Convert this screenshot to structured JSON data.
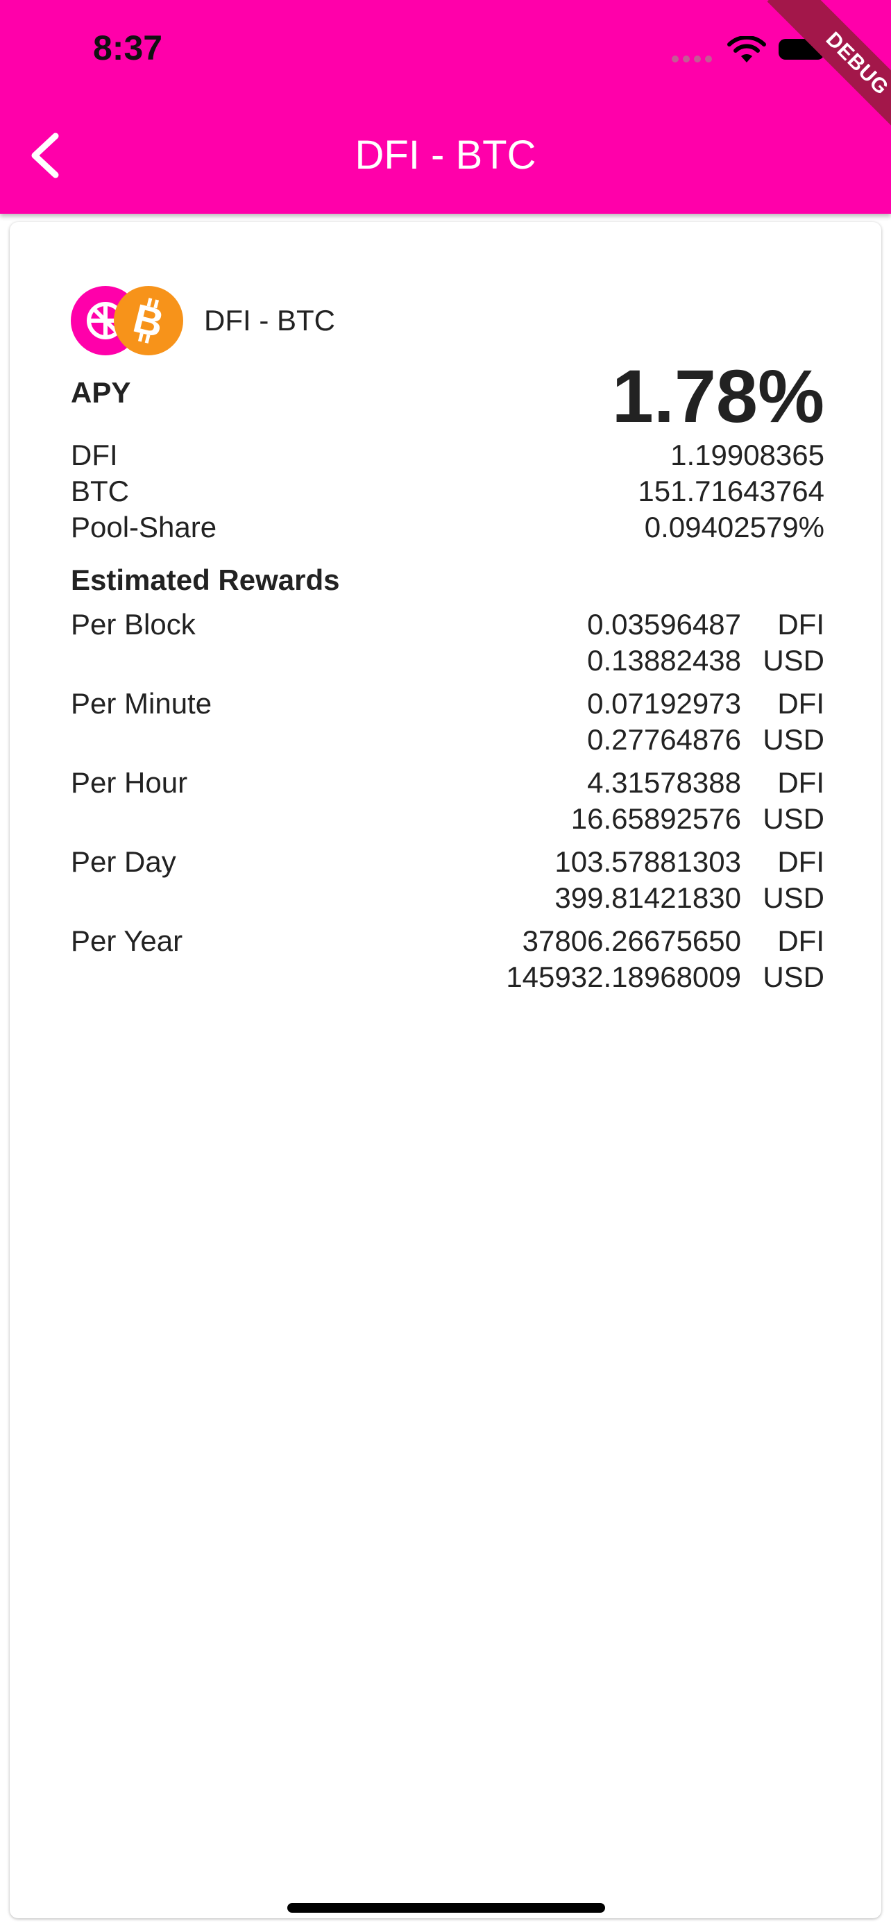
{
  "status_bar": {
    "time": "8:37"
  },
  "debug_banner": "DEBUG",
  "appbar": {
    "title": "DFI - BTC"
  },
  "pair": {
    "name": "DFI - BTC"
  },
  "apy": {
    "label": "APY",
    "value": "1.78%"
  },
  "info": [
    {
      "label": "DFI",
      "value": "1.19908365"
    },
    {
      "label": "BTC",
      "value": "151.71643764"
    },
    {
      "label": "Pool-Share",
      "value": "0.09402579%"
    }
  ],
  "rewards": {
    "title": "Estimated Rewards",
    "items": [
      {
        "label": "Per Block",
        "dfi": "0.03596487",
        "dfi_unit": "DFI",
        "usd": "0.13882438",
        "usd_unit": "USD"
      },
      {
        "label": "Per Minute",
        "dfi": "0.07192973",
        "dfi_unit": "DFI",
        "usd": "0.27764876",
        "usd_unit": "USD"
      },
      {
        "label": "Per Hour",
        "dfi": "4.31578388",
        "dfi_unit": "DFI",
        "usd": "16.65892576",
        "usd_unit": "USD"
      },
      {
        "label": "Per Day",
        "dfi": "103.57881303",
        "dfi_unit": "DFI",
        "usd": "399.81421830",
        "usd_unit": "USD"
      },
      {
        "label": "Per Year",
        "dfi": "37806.26675650",
        "dfi_unit": "DFI",
        "usd": "145932.18968009",
        "usd_unit": "USD"
      }
    ]
  },
  "colors": {
    "accent": "#ff00aa",
    "btc": "#f7931a",
    "dfi": "#ff00aa",
    "debug": "#a3174a"
  },
  "icons": [
    "back-arrow-icon",
    "wifi-icon",
    "battery-icon",
    "dfi-logo-icon",
    "btc-logo-icon"
  ]
}
